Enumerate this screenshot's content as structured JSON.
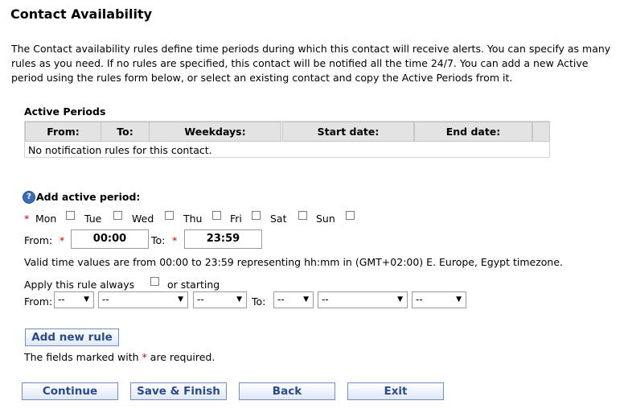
{
  "title": "Contact Availability",
  "intro": "The Contact availability rules define time periods during which this contact will receive alerts. You can specify as many rules as you need. If no rules are specified, this contact will be notified all the time 24/7. You can add a new Active period using the rules form below, or select an existing contact and copy the Active Periods from it.",
  "active_periods": {
    "heading": "Active Periods",
    "columns": [
      "From:",
      "To:",
      "Weekdays:",
      "Start date:",
      "End date:",
      ""
    ],
    "empty_message": "No notification rules for this contact."
  },
  "add_period": {
    "help_icon": "question-circle-icon",
    "heading": "Add active period:",
    "required_mark": "*",
    "days": [
      "Mon",
      "Tue",
      "Wed",
      "Thu",
      "Fri",
      "Sat",
      "Sun"
    ],
    "from_label": "From:",
    "from_value": "00:00",
    "to_label": "To:",
    "to_value": "23:59",
    "valid_note": "Valid time values are from 00:00 to 23:59 representing hh:mm in (GMT+02:00) E. Europe, Egypt timezone.",
    "apply_always_label": "Apply this rule always",
    "or_starting_label": "or starting",
    "date_from_label": "From:",
    "date_to_label": "To:",
    "date_from_selects": [
      "--",
      "--",
      "--"
    ],
    "date_to_selects": [
      "--",
      "--",
      "--"
    ]
  },
  "add_rule_button": "Add new rule",
  "required_note_before": "The fields marked with",
  "required_note_after": "are required.",
  "buttons": {
    "continue": "Continue",
    "save_finish": "Save & Finish",
    "back": "Back",
    "exit": "Exit"
  },
  "colors": {
    "button_text": "#2b4a8a",
    "required": "#cc0000",
    "table_header_bg": "#e3e3e3"
  }
}
